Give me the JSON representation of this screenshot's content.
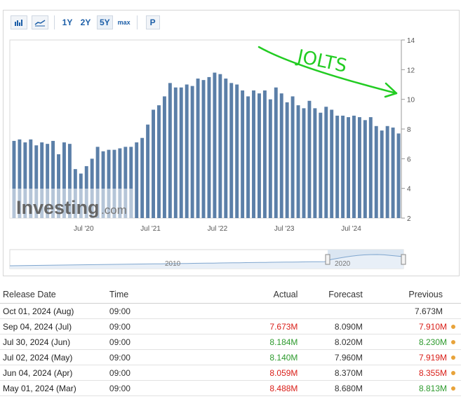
{
  "toolbar": {
    "ranges": [
      "1Y",
      "2Y",
      "5Y",
      "max"
    ],
    "active_range": "5Y",
    "print_label": "P",
    "icons": [
      "bar-chart-icon",
      "line-chart-icon"
    ]
  },
  "watermark": {
    "brand": "Investing",
    "suffix": ".com"
  },
  "annotation": {
    "text": "JOLTS",
    "color": "#22cc22"
  },
  "colors": {
    "bar": "#5b7fa8",
    "navigator_fill": "#dbe6f2",
    "navigator_line": "#7fa6cf",
    "accent": "#1d5fa8"
  },
  "chart_data": {
    "type": "bar",
    "y_ticks": [
      "14",
      "12",
      "10",
      "8",
      "6",
      "4",
      "2"
    ],
    "ylim": [
      2,
      14
    ],
    "x_tick_labels": [
      "Jul '20",
      "Jul '21",
      "Jul '22",
      "Jul '23",
      "Jul '24"
    ],
    "x_tick_positions": [
      13,
      25,
      37,
      49,
      61
    ],
    "values": [
      7.2,
      7.3,
      7.1,
      7.3,
      6.9,
      7.1,
      7.0,
      7.2,
      6.3,
      7.1,
      7.0,
      5.3,
      5.0,
      5.5,
      6.0,
      6.8,
      6.5,
      6.6,
      6.6,
      6.7,
      6.8,
      6.8,
      7.1,
      7.4,
      8.3,
      9.3,
      9.6,
      10.2,
      11.1,
      10.8,
      10.8,
      11.0,
      10.9,
      11.4,
      11.3,
      11.5,
      11.8,
      11.7,
      11.4,
      11.1,
      11.0,
      10.6,
      10.2,
      10.6,
      10.4,
      10.6,
      10.0,
      10.8,
      10.4,
      9.8,
      10.2,
      9.6,
      9.4,
      9.9,
      9.4,
      9.1,
      9.5,
      9.3,
      8.9,
      8.9,
      8.8,
      8.9,
      8.8,
      8.6,
      8.8,
      8.2,
      7.9,
      8.2,
      8.1,
      7.7
    ],
    "navigator": {
      "labels": [
        "2010",
        "2020"
      ]
    }
  },
  "table": {
    "headers": [
      "Release Date",
      "Time",
      "Actual",
      "Forecast",
      "Previous"
    ],
    "rows": [
      {
        "date": "Oct 01, 2024 (Aug)",
        "time": "09:00",
        "actual": "",
        "actual_color": "",
        "forecast": "",
        "previous": "7.673M",
        "previous_color": "",
        "dot": false
      },
      {
        "date": "Sep 04, 2024 (Jul)",
        "time": "09:00",
        "actual": "7.673M",
        "actual_color": "red",
        "forecast": "8.090M",
        "previous": "7.910M",
        "previous_color": "red",
        "dot": true
      },
      {
        "date": "Jul 30, 2024 (Jun)",
        "time": "09:00",
        "actual": "8.184M",
        "actual_color": "green",
        "forecast": "8.020M",
        "previous": "8.230M",
        "previous_color": "green",
        "dot": true
      },
      {
        "date": "Jul 02, 2024 (May)",
        "time": "09:00",
        "actual": "8.140M",
        "actual_color": "green",
        "forecast": "7.960M",
        "previous": "7.919M",
        "previous_color": "red",
        "dot": true
      },
      {
        "date": "Jun 04, 2024 (Apr)",
        "time": "09:00",
        "actual": "8.059M",
        "actual_color": "red",
        "forecast": "8.370M",
        "previous": "8.355M",
        "previous_color": "red",
        "dot": true
      },
      {
        "date": "May 01, 2024 (Mar)",
        "time": "09:00",
        "actual": "8.488M",
        "actual_color": "red",
        "forecast": "8.680M",
        "previous": "8.813M",
        "previous_color": "green",
        "dot": true
      }
    ]
  }
}
